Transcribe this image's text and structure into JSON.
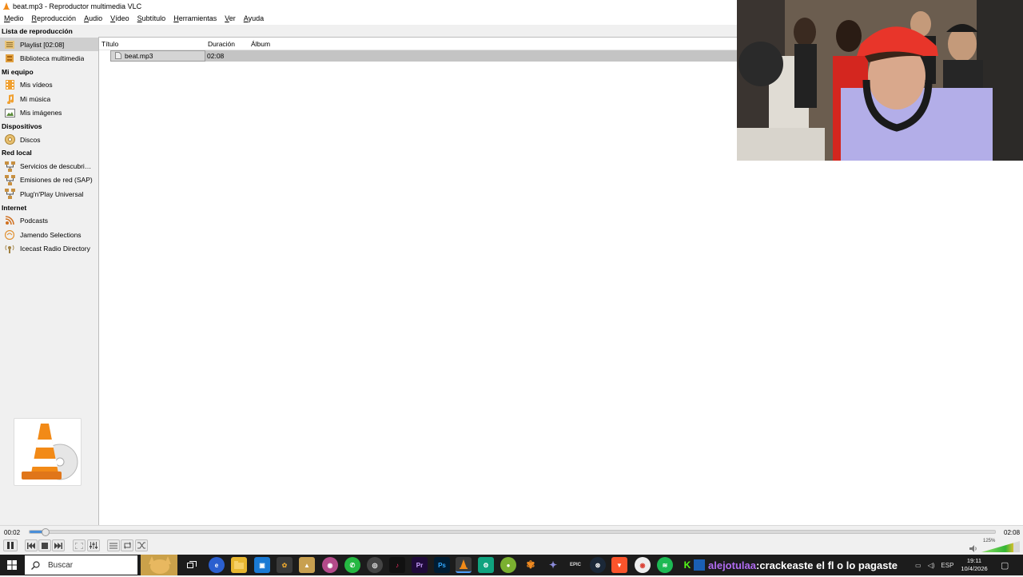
{
  "window": {
    "title": "beat.mp3 - Reproductor multimedia VLC"
  },
  "menu": [
    "Medio",
    "Reproducción",
    "Audio",
    "Vídeo",
    "Subtítulo",
    "Herramientas",
    "Ver",
    "Ayuda"
  ],
  "sidebar": {
    "sections": [
      {
        "title": "Lista de reproducción",
        "items": [
          {
            "label": "Playlist [02:08]",
            "icon": "playlist-icon",
            "active": true
          },
          {
            "label": "Biblioteca multimedia",
            "icon": "library-icon"
          }
        ]
      },
      {
        "title": "Mi equipo",
        "items": [
          {
            "label": "Mis vídeos",
            "icon": "videos-icon"
          },
          {
            "label": "Mi música",
            "icon": "music-icon"
          },
          {
            "label": "Mis imágenes",
            "icon": "images-icon"
          }
        ]
      },
      {
        "title": "Dispositivos",
        "items": [
          {
            "label": "Discos",
            "icon": "disc-icon"
          }
        ]
      },
      {
        "title": "Red local",
        "items": [
          {
            "label": "Servicios de descubrimie...",
            "icon": "network-icon"
          },
          {
            "label": "Emisiones de red (SAP)",
            "icon": "network-icon"
          },
          {
            "label": "Plug'n'Play Universal",
            "icon": "network-icon"
          }
        ]
      },
      {
        "title": "Internet",
        "items": [
          {
            "label": "Podcasts",
            "icon": "podcast-icon"
          },
          {
            "label": "Jamendo Selections",
            "icon": "jamendo-icon"
          },
          {
            "label": "Icecast Radio Directory",
            "icon": "radio-icon"
          }
        ]
      }
    ]
  },
  "playlist": {
    "columns": {
      "title": "Título",
      "duration": "Duración",
      "album": "Álbum"
    },
    "rows": [
      {
        "title": "beat.mp3",
        "duration": "02:08",
        "album": ""
      }
    ]
  },
  "controls": {
    "elapsed": "00:02",
    "total": "02:08",
    "progress": 0.016,
    "volume_label": "125%",
    "volume": 1.25
  },
  "taskbar": {
    "search_placeholder": "Buscar",
    "chat_user": "alejotulaa",
    "chat_separator": " : ",
    "chat_message": "crackeaste el fl o lo pagaste",
    "lang": "ESP",
    "time": "19:11",
    "date": "10/4/2026"
  },
  "colors": {
    "accent": "#4a8ed8",
    "selection": "#c4c4c4",
    "vlc_orange": "#f28a17",
    "chat_user": "#b06cf0"
  }
}
